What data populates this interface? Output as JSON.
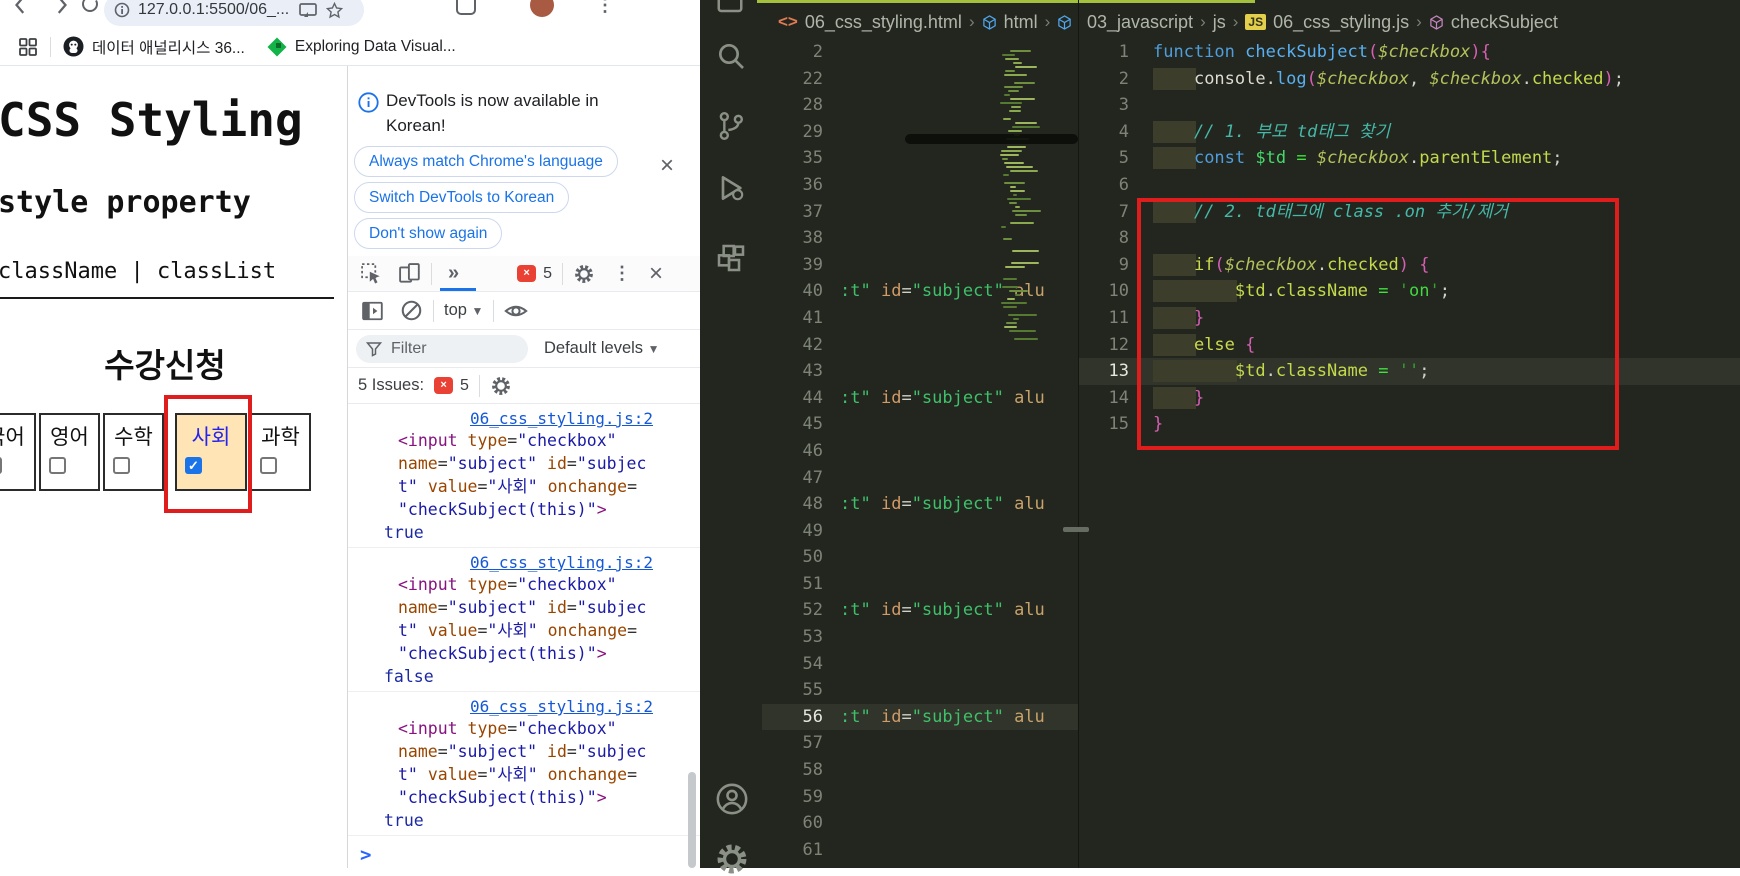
{
  "colors": {
    "annotation_red": "#e01d1d",
    "highlight_cell_bg": "#ffe4b5",
    "highlight_cell_text": "#2424ee",
    "checkbox_checked_blue": "#1a73e8",
    "devtools_link_blue": "#1558d6",
    "vscode_topline_green": "#a3c13c"
  },
  "browser": {
    "url": "127.0.0.1:5500/06_...",
    "bookmarks": {
      "item1": "데이터 애널리시스 36...",
      "item2": "Exploring Data Visual...",
      "overflow_icon": "»"
    },
    "page": {
      "h1": "CSS Styling",
      "h2": "style property",
      "subtitle": "className | classList",
      "table": {
        "caption": "수강신청",
        "subjects": [
          {
            "label": "국어",
            "checked": false,
            "highlight": false
          },
          {
            "label": "영어",
            "checked": false,
            "highlight": false
          },
          {
            "label": "수학",
            "checked": false,
            "highlight": false
          },
          {
            "label": "사회",
            "checked": true,
            "highlight": true
          },
          {
            "label": "과학",
            "checked": false,
            "highlight": false
          }
        ],
        "check_glyph": "✓"
      }
    }
  },
  "devtools": {
    "notification": {
      "text": "DevTools is now available in Korean!",
      "buttons": [
        "Always match Chrome's language",
        "Switch DevTools to Korean",
        "Don't show again"
      ],
      "close_icon": "×"
    },
    "toolbar": {
      "more_tabs_icon": "»",
      "errors_count": "5",
      "menu_icon": "⋮",
      "close_icon": "×",
      "context_label": "top",
      "dropdown_icon": "▾",
      "filter_placeholder": "Filter",
      "levels_label": "Default levels",
      "issues_label": "5 Issues:",
      "issues_count": "5"
    },
    "console": {
      "prompt": ">",
      "log_lines": [
        [
          [
            "ct",
            "<input "
          ],
          [
            "ca",
            "type"
          ],
          [
            "cp",
            "="
          ],
          [
            "cv",
            "\"checkbox\""
          ]
        ],
        [
          [
            "ca",
            "name"
          ],
          [
            "cp",
            "="
          ],
          [
            "cv",
            "\"subject\""
          ],
          [
            "cp",
            " "
          ],
          [
            "ca",
            "id"
          ],
          [
            "cp",
            "="
          ],
          [
            "cv",
            "\"subjec"
          ]
        ],
        [
          [
            "cv",
            "t\" "
          ],
          [
            "ca",
            "value"
          ],
          [
            "cp",
            "="
          ],
          [
            "cv",
            "\"사회\""
          ],
          [
            "cp",
            " "
          ],
          [
            "ca",
            "onchange"
          ],
          [
            "cp",
            "="
          ]
        ],
        [
          [
            "cv",
            "\"checkSubject(this)\""
          ],
          [
            "ct",
            ">"
          ]
        ]
      ],
      "entries": [
        {
          "link": "06_css_styling.js:2",
          "result": "true"
        },
        {
          "link": "06_css_styling.js:2",
          "result": "false"
        },
        {
          "link": "06_css_styling.js:2",
          "result": "true"
        }
      ]
    }
  },
  "vscode": {
    "left_editor": {
      "breadcrumb": {
        "file": "06_css_styling.html",
        "node1": "html"
      },
      "line_numbers": [
        2,
        22,
        28,
        29,
        35,
        36,
        37,
        38,
        39,
        40,
        41,
        42,
        43,
        44,
        45,
        46,
        47,
        48,
        49,
        50,
        51,
        52,
        53,
        54,
        55,
        56,
        57,
        58,
        59,
        60,
        61
      ],
      "fragment_lines": [
        40,
        44,
        48,
        52,
        56
      ],
      "fragment": [
        [
          "hs",
          ":t\" "
        ],
        [
          "ha",
          "id"
        ],
        [
          "pl",
          "="
        ],
        [
          "hs",
          "\"subject\""
        ],
        [
          "pl",
          " "
        ],
        [
          "tn",
          "alu"
        ]
      ],
      "active_line": 56
    },
    "right_editor": {
      "breadcrumb": {
        "folder": "03_javascript",
        "subfolder": "js",
        "file": "06_css_styling.js",
        "symbol": "checkSubject"
      },
      "active_line": 13,
      "code": [
        {
          "n": 1,
          "seg": [
            [
              "kw",
              "function"
            ],
            [
              "pl",
              " "
            ],
            [
              "fn",
              "checkSubject"
            ],
            [
              "pk",
              "("
            ],
            [
              "pm",
              "$checkbox"
            ],
            [
              "pk",
              "){"
            ]
          ]
        },
        {
          "n": 2,
          "ind": 4,
          "seg": [
            [
              "pl",
              "    "
            ],
            [
              "cn",
              "console"
            ],
            [
              "pl",
              "."
            ],
            [
              "fn",
              "log"
            ],
            [
              "pk",
              "("
            ],
            [
              "pm",
              "$checkbox"
            ],
            [
              "pl",
              ", "
            ],
            [
              "pm",
              "$checkbox"
            ],
            [
              "pl",
              "."
            ],
            [
              "id",
              "checked"
            ],
            [
              "pk",
              ")"
            ],
            [
              "pl",
              ";"
            ]
          ]
        },
        {
          "n": 3,
          "seg": []
        },
        {
          "n": 4,
          "ind": 4,
          "seg": [
            [
              "pl",
              "    "
            ],
            [
              "cm",
              "// 1. 부모 td태그 찾기"
            ]
          ]
        },
        {
          "n": 5,
          "ind": 4,
          "seg": [
            [
              "pl",
              "    "
            ],
            [
              "kw",
              "const"
            ],
            [
              "pl",
              " "
            ],
            [
              "vr",
              "$td"
            ],
            [
              "pl",
              " "
            ],
            [
              "op",
              "="
            ],
            [
              "pl",
              " "
            ],
            [
              "pm",
              "$checkbox"
            ],
            [
              "pl",
              "."
            ],
            [
              "id",
              "parentElement"
            ],
            [
              "pl",
              ";"
            ]
          ]
        },
        {
          "n": 6,
          "seg": []
        },
        {
          "n": 7,
          "ind": 4,
          "seg": [
            [
              "pl",
              "    "
            ],
            [
              "cm",
              "// 2. td태그에 class .on 추가/제거"
            ]
          ]
        },
        {
          "n": 8,
          "seg": []
        },
        {
          "n": 9,
          "ind": 4,
          "seg": [
            [
              "pl",
              "    "
            ],
            [
              "k2",
              "if"
            ],
            [
              "pk",
              "("
            ],
            [
              "pm",
              "$checkbox"
            ],
            [
              "pl",
              "."
            ],
            [
              "id",
              "checked"
            ],
            [
              "pk",
              ")"
            ],
            [
              "pl",
              " "
            ],
            [
              "pk",
              "{"
            ]
          ]
        },
        {
          "n": 10,
          "ind": 8,
          "seg": [
            [
              "pl",
              "        "
            ],
            [
              "id",
              "$td"
            ],
            [
              "pl",
              "."
            ],
            [
              "id",
              "className"
            ],
            [
              "pl",
              " "
            ],
            [
              "op",
              "="
            ],
            [
              "pl",
              " "
            ],
            [
              "sq",
              "'"
            ],
            [
              "st",
              "on"
            ],
            [
              "sq",
              "'"
            ],
            [
              "pl",
              ";"
            ]
          ]
        },
        {
          "n": 11,
          "ind": 4,
          "seg": [
            [
              "pl",
              "    "
            ],
            [
              "pk",
              "}"
            ]
          ]
        },
        {
          "n": 12,
          "ind": 4,
          "seg": [
            [
              "pl",
              "    "
            ],
            [
              "k2",
              "else"
            ],
            [
              "pl",
              " "
            ],
            [
              "pk",
              "{"
            ]
          ]
        },
        {
          "n": 13,
          "ind": 8,
          "seg": [
            [
              "pl",
              "        "
            ],
            [
              "id",
              "$td"
            ],
            [
              "pl",
              "."
            ],
            [
              "id",
              "className"
            ],
            [
              "pl",
              " "
            ],
            [
              "op",
              "="
            ],
            [
              "pl",
              " "
            ],
            [
              "sq",
              "''"
            ],
            [
              "pl",
              ";"
            ]
          ]
        },
        {
          "n": 14,
          "ind": 4,
          "seg": [
            [
              "pl",
              "    "
            ],
            [
              "pk",
              "}"
            ]
          ]
        },
        {
          "n": 15,
          "seg": [
            [
              "pk",
              "}"
            ]
          ]
        }
      ]
    }
  }
}
